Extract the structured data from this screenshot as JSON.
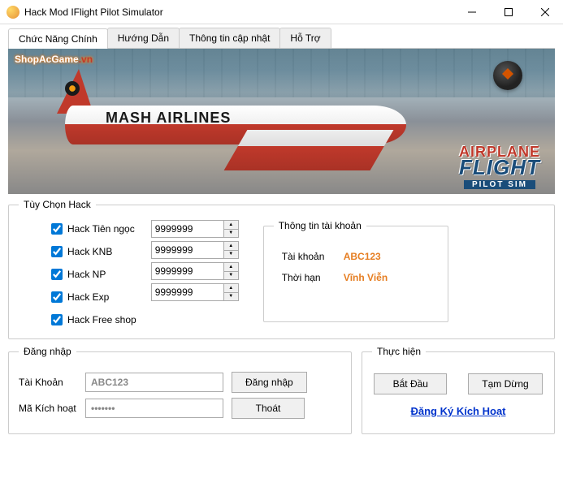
{
  "window": {
    "title": "Hack Mod IFlight Pilot Simulator"
  },
  "tabs": [
    {
      "label": "Chức Năng Chính",
      "active": true
    },
    {
      "label": "Hướng Dẫn"
    },
    {
      "label": "Thông tin cập nhật"
    },
    {
      "label": "Hỗ Trợ"
    }
  ],
  "banner": {
    "watermark": "ShopAcGame",
    "watermark_suffix": ".vn",
    "plane": "MASH AIRLINES",
    "logo_line1": "AIRPLANE",
    "logo_line2": "FLIGHT",
    "logo_line3": "PILOT SIM"
  },
  "hack": {
    "legend": "Tùy Chọn Hack",
    "opts": [
      {
        "label": "Hack Tiên ngọc",
        "value": "9999999"
      },
      {
        "label": "Hack KNB",
        "value": "9999999"
      },
      {
        "label": "Hack NP",
        "value": "9999999"
      },
      {
        "label": "Hack Exp",
        "value": "9999999"
      },
      {
        "label": "Hack Free shop"
      }
    ]
  },
  "account_info": {
    "legend": "Thông tin tài khoản",
    "user_label": "Tài khoản",
    "user_value": "ABC123",
    "expiry_label": "Thời hạn",
    "expiry_value": "Vĩnh Viễn"
  },
  "login": {
    "legend": "Đăng nhập",
    "user_label": "Tài Khoản",
    "user_value": "ABC123",
    "code_label": "Mã Kích hoạt",
    "code_value": "•••••••",
    "btn_login": "Đăng nhập",
    "btn_exit": "Thoát"
  },
  "exec": {
    "legend": "Thực hiện",
    "btn_start": "Bắt Đầu",
    "btn_pause": "Tạm Dừng",
    "reg_link": "Đăng Ký Kích Hoạt"
  }
}
